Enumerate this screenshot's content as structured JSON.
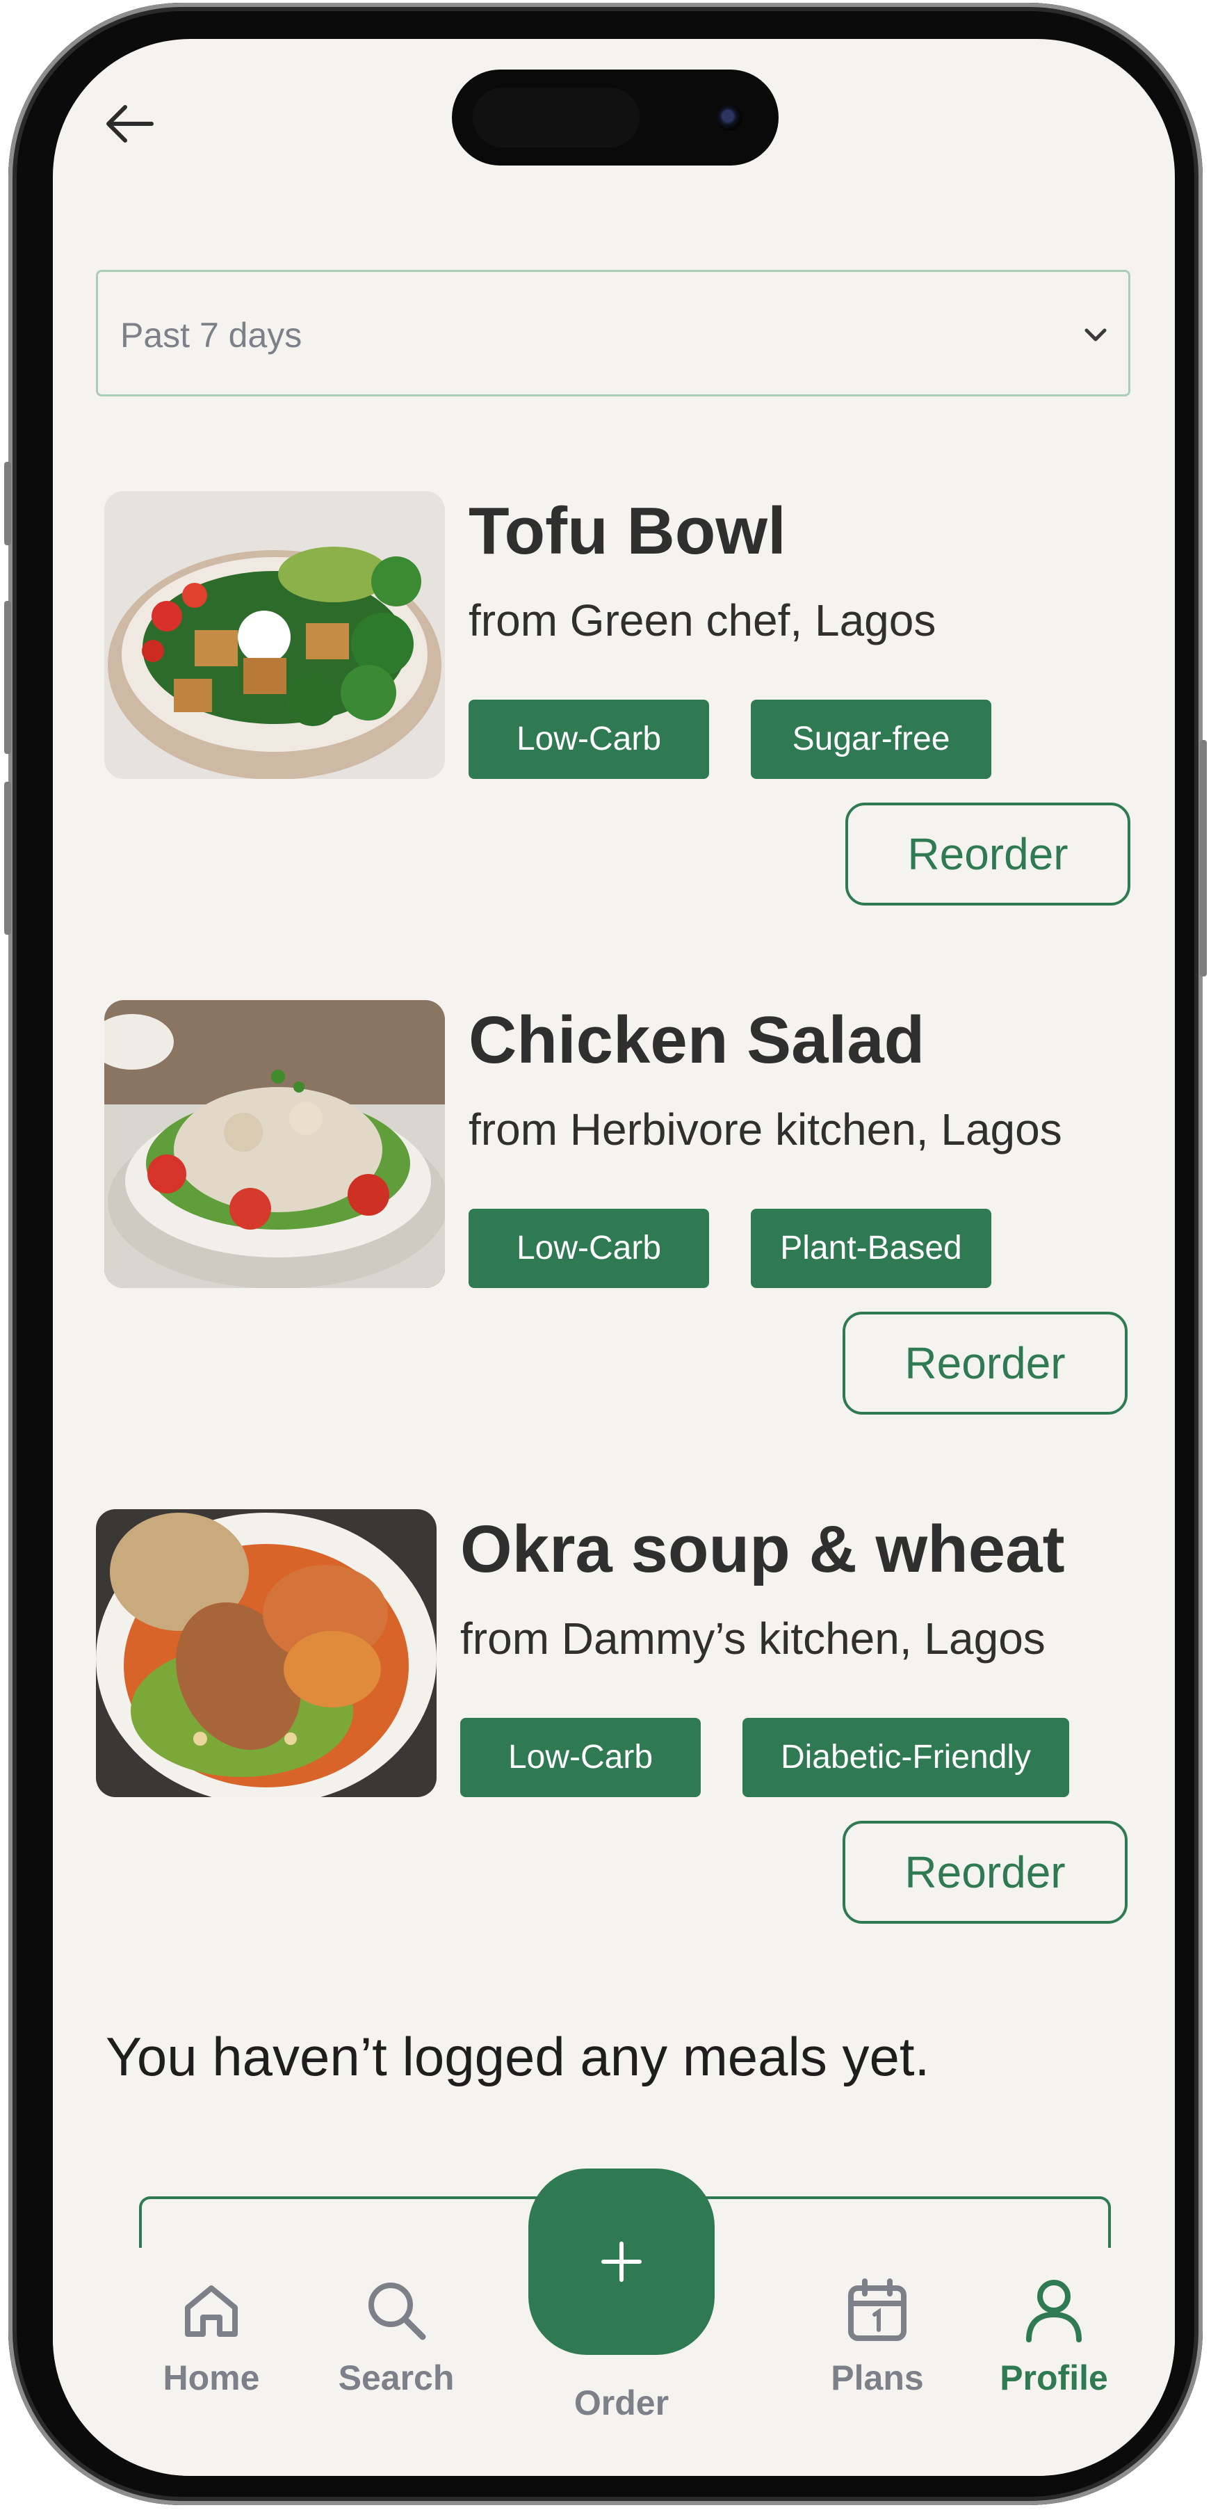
{
  "filter": {
    "selected": "Past 7 days"
  },
  "meals": [
    {
      "name": "Tofu Bowl",
      "from": "from Green chef, Lagos",
      "tags": [
        "Low-Carb",
        "Sugar-free"
      ],
      "reorder_label": "Reorder"
    },
    {
      "name": "Chicken Salad",
      "from": "from Herbivore kitchen, Lagos",
      "tags": [
        "Low-Carb",
        "Plant-Based"
      ],
      "reorder_label": "Reorder"
    },
    {
      "name": "Okra soup & wheat",
      "from": "from Dammy’s kitchen, Lagos",
      "tags": [
        "Low-Carb",
        "Diabetic-Friendly"
      ],
      "reorder_label": "Reorder"
    }
  ],
  "empty_state": {
    "message": "You haven’t logged any meals yet."
  },
  "tabbar": {
    "items": [
      {
        "label": "Home",
        "icon": "home-icon"
      },
      {
        "label": "Search",
        "icon": "search-icon"
      },
      {
        "label": "Order",
        "icon": "plus-icon"
      },
      {
        "label": "Plans",
        "icon": "calendar-icon"
      },
      {
        "label": "Profile",
        "icon": "user-icon"
      }
    ],
    "active": "Profile"
  },
  "colors": {
    "accent": "#2f7a52",
    "background": "#f4f3ef",
    "muted": "#7d8088",
    "text": "#2f2f2f"
  }
}
